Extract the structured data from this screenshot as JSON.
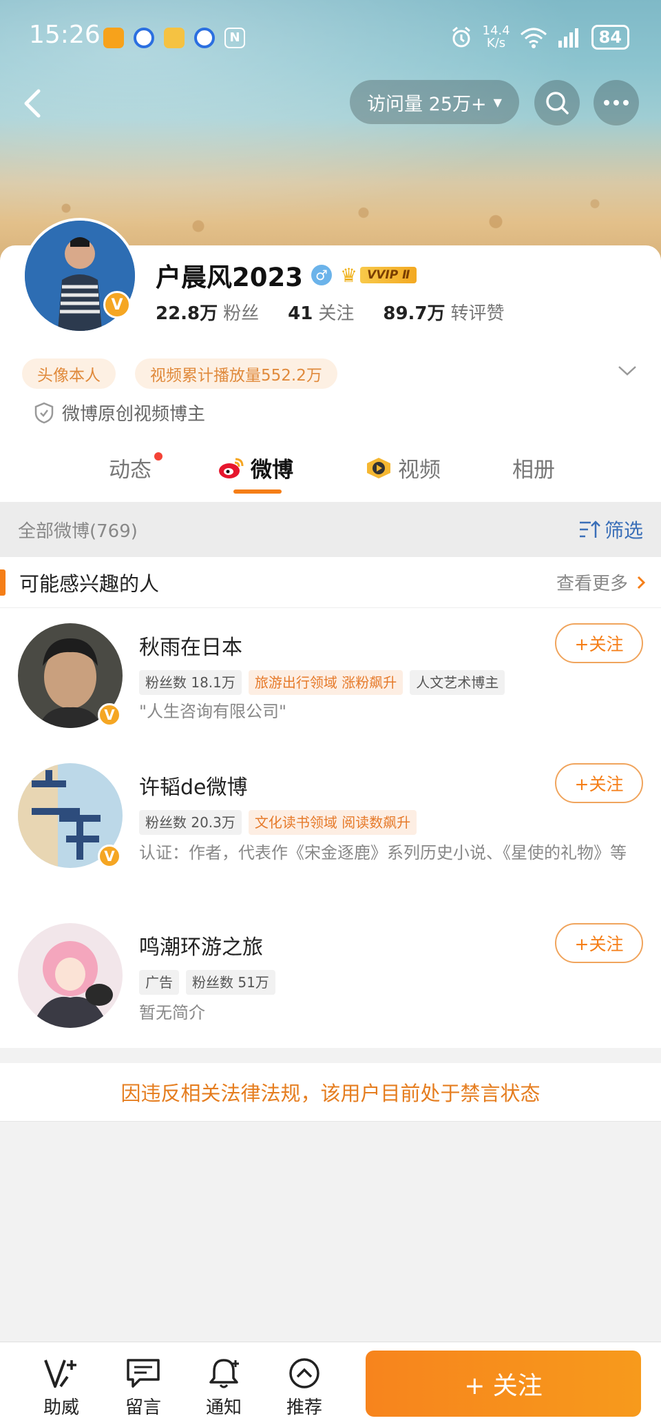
{
  "status_bar": {
    "time": "15:26",
    "net_speed_value": "14.4",
    "net_speed_unit": "K/s",
    "battery": "84"
  },
  "header": {
    "visits_label": "访问量 25万+"
  },
  "profile": {
    "name": "户晨风2023",
    "vip_label": "VVIP Ⅱ",
    "stats": [
      {
        "value": "22.8万",
        "label": "粉丝"
      },
      {
        "value": "41",
        "label": "关注"
      },
      {
        "value": "89.7万",
        "label": "转评赞"
      }
    ],
    "tags": [
      "头像本人",
      "视频累计播放量552.2万"
    ],
    "creator_label": "微博原创视频博主"
  },
  "tabs": [
    {
      "label": "动态"
    },
    {
      "label": "微博"
    },
    {
      "label": "视频"
    },
    {
      "label": "相册"
    }
  ],
  "filter": {
    "count_label": "全部微博(769)",
    "filter_label": "筛选"
  },
  "suggest": {
    "title": "可能感兴趣的人",
    "see_more": "查看更多",
    "follow_label": "+关注",
    "users": [
      {
        "name": "秋雨在日本",
        "tags": [
          "粉丝数 18.1万",
          "旅游出行领域 涨粉飙升",
          "人文艺术博主"
        ],
        "desc": "\"人生咨询有限公司\""
      },
      {
        "name": "许韬de微博",
        "tags": [
          "粉丝数 20.3万",
          "文化读书领域 阅读数飙升"
        ],
        "desc": "认证：作者，代表作《宋金逐鹿》系列历史小说、《星使的礼物》等"
      },
      {
        "name": "鸣潮环游之旅",
        "tags": [
          "广告",
          "粉丝数 51万"
        ],
        "desc": "暂无简介"
      }
    ]
  },
  "ban_notice": "因违反相关法律法规，该用户目前处于禁言状态",
  "bottom_bar": {
    "items": [
      "助威",
      "留言",
      "通知",
      "推荐"
    ],
    "follow_button": "+ 关注"
  },
  "colors": {
    "accent": "#f57e17",
    "tag_text": "#e08a3c",
    "filter_blue": "#3a6fb8"
  }
}
